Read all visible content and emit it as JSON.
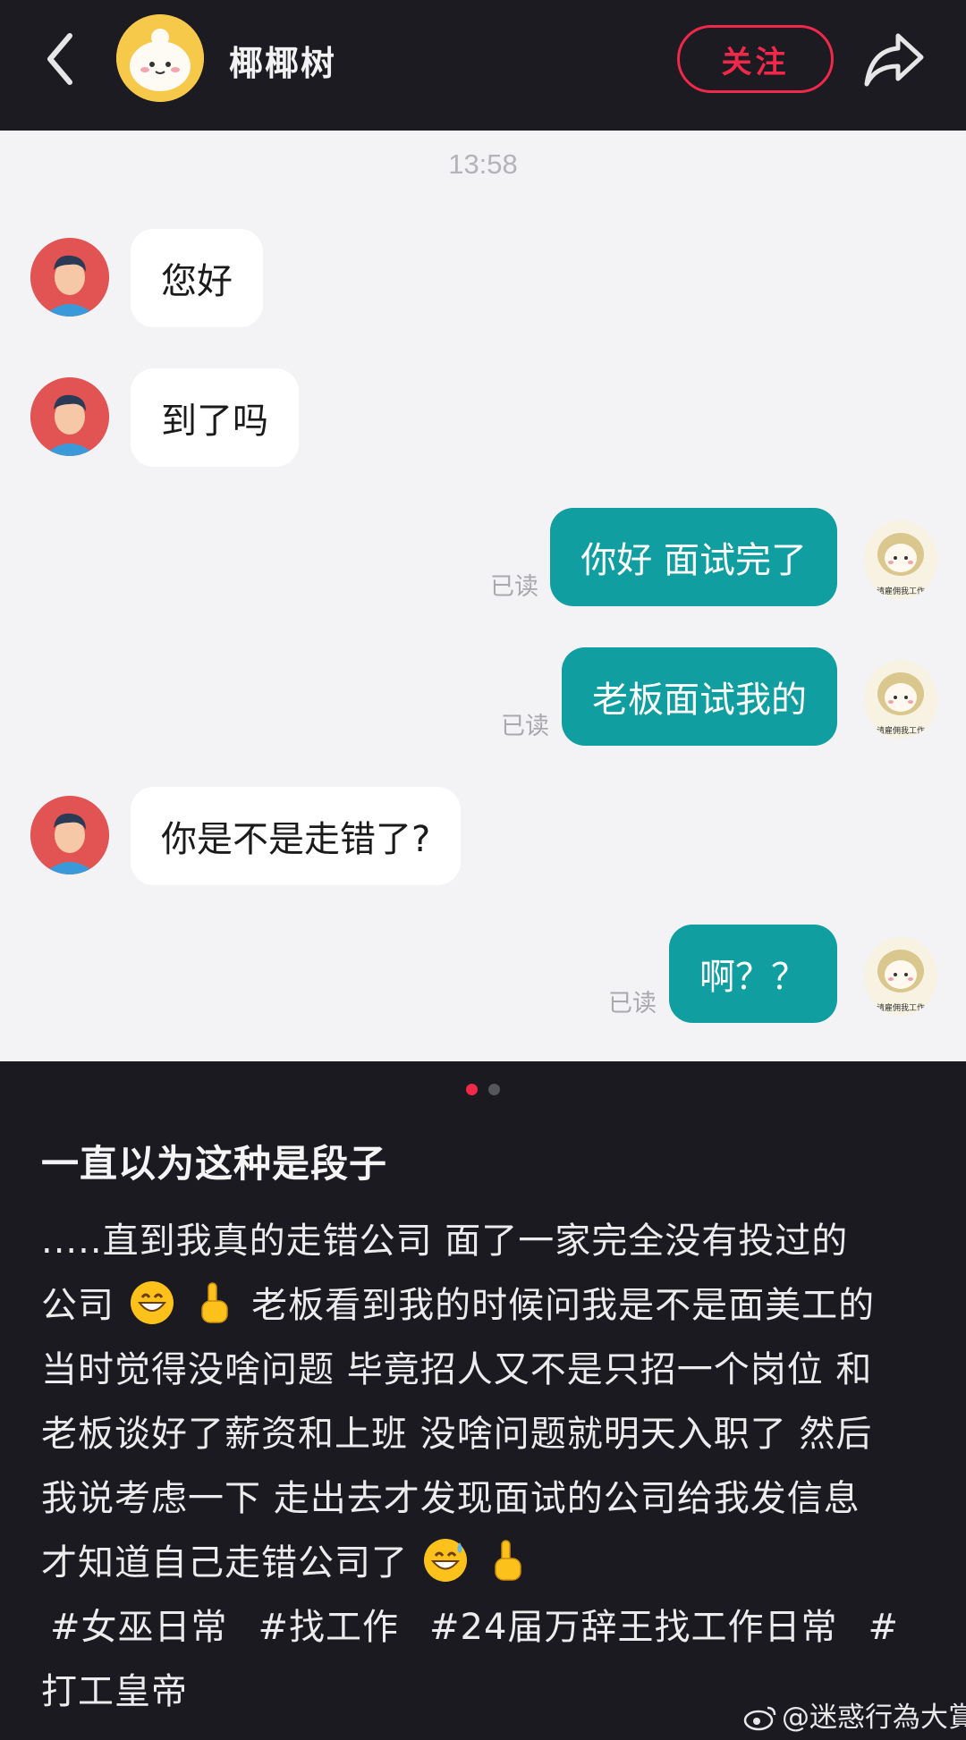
{
  "header": {
    "name": "椰椰树",
    "follow_label": "关注",
    "back_icon": "chevron-left-icon",
    "share_icon": "share-arrow-icon"
  },
  "chat": {
    "timestamp": "13:58",
    "messages": [
      {
        "side": "left",
        "text": "您好"
      },
      {
        "side": "left",
        "text": "到了吗"
      },
      {
        "side": "right",
        "text": "你好 面试完了",
        "status": "已读"
      },
      {
        "side": "right",
        "text": "老板面试我的",
        "status": "已读"
      },
      {
        "side": "left",
        "text": "你是不是走错了?"
      },
      {
        "side": "right",
        "text": "啊？？",
        "status": "已读"
      }
    ],
    "self_avatar_caption": "请雇佣我工作"
  },
  "pagination": {
    "total": 2,
    "current": 1
  },
  "post": {
    "title": "一直以为这种是段子",
    "lines": [
      ".....直到我真的走错公司 面了一家完全没有投过的",
      "公司",
      "老板看到我的时候问我是不是面美工的",
      "当时觉得没啥问题 毕竟招人又不是只招一个岗位 和",
      "老板谈好了薪资和上班 没啥问题就明天入职了 然后",
      "我说考虑一下 走出去才发现面试的公司给我发信息",
      "才知道自己走错公司了"
    ],
    "tags": [
      "#女巫日常",
      "#找工作",
      "#24届万辞王找工作日常",
      "#",
      "打工皇帝"
    ]
  },
  "watermark": "@迷惑行為大賞",
  "colors": {
    "accent": "#f0284a",
    "bubble_self": "#119ea0",
    "header_bg": "#1b1b21",
    "chat_bg": "#f3f3f6"
  }
}
